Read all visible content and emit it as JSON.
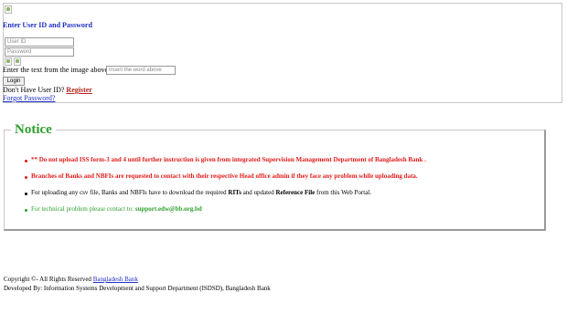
{
  "login": {
    "heading": "Enter User ID and Password",
    "user_id_placeholder": "User ID",
    "password_placeholder": "Password",
    "captcha_label": "Enter the text from the image above",
    "captcha_placeholder": "Insert the word above",
    "login_button": "Login",
    "no_user_id_text": "Don't Have User ID?",
    "register_link": "Register",
    "forgot_link": "Forgot Password?"
  },
  "notice": {
    "title": "Notice",
    "items": [
      {
        "text": "** Do not upload ISS form-3 and 4 until further instruction is given from integrated Supervision Management Department of Bangladesh Bank .",
        "color": "#e01b1b"
      },
      {
        "text": "Branches of Banks and NBFIs are requested to contact with their respective Head office admin if they face any problem while uploading data.",
        "color": "#e01b1b"
      },
      {
        "text_pre": "For uploading any csv file, Banks and NBFIs have to download the required",
        "bold1": "RITs",
        "text_mid": "and updated",
        "bold2": "Reference File",
        "text_post": "from this Web Portal.",
        "color": "#000000"
      },
      {
        "text_pre": "For technical problem please contact to:",
        "bold": "support.edw@bb.org.bd",
        "color": "#2e9e2e"
      }
    ]
  },
  "footer": {
    "copyright_text": "Copyright ©- All Rights Reserved",
    "copyright_link": "Bangladesh Bank",
    "developed_by": "Developed By: Information Systems Development and Support Department (ISDSD), Bangladesh Bank"
  }
}
